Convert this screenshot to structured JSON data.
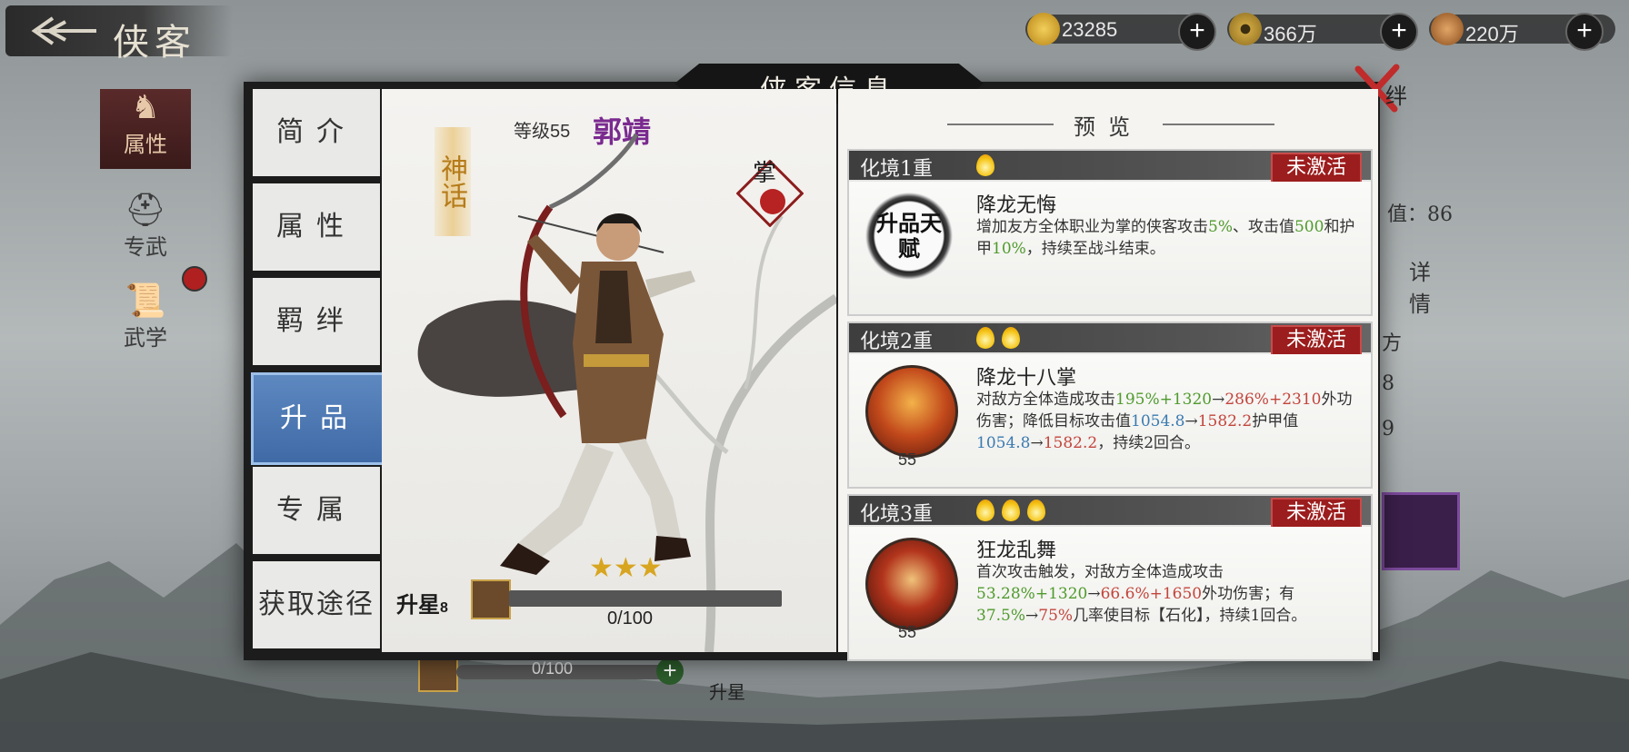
{
  "topbar": {
    "back_title": "侠客",
    "resources": [
      {
        "name": "gold-ingot",
        "value": "23285",
        "color": "#d9a62a"
      },
      {
        "name": "copper-coin",
        "value": "366万",
        "color": "#b98a2b"
      },
      {
        "name": "money-bag",
        "value": "220万",
        "color": "#c27a36"
      }
    ]
  },
  "left_nav": {
    "items": [
      {
        "label": "属性"
      },
      {
        "label": "专武"
      },
      {
        "label": "武学"
      }
    ]
  },
  "background": {
    "bottom_progress": "0/100",
    "bottom_label": "升星",
    "peek_values": [
      "值：86",
      "详情",
      "方",
      "8",
      "9"
    ]
  },
  "modal": {
    "title": "侠客信息",
    "close_label": "绊",
    "tabs": [
      {
        "label": "简介",
        "active": false
      },
      {
        "label": "属性",
        "active": false
      },
      {
        "label": "羁绊",
        "active": false
      },
      {
        "label": "升品",
        "active": true
      },
      {
        "label": "专属",
        "active": false
      },
      {
        "label": "获取途径",
        "active": false
      }
    ],
    "hero": {
      "rank": "神话",
      "level_label": "等级",
      "level": "55",
      "name": "郭靖",
      "seal": "掌",
      "stars": "★★★",
      "star_up_label": "升星",
      "star_up_count": "8",
      "star_progress": "0/100",
      "star_progress_fraction": 0
    },
    "preview": {
      "title": "预览",
      "cards": [
        {
          "tier": "化境1重",
          "suns": 1,
          "status": "未激活",
          "icon": "talent-seal-icon",
          "icon_text": "升品天赋",
          "level": "",
          "skill": "降龙无悔",
          "desc_parts": [
            {
              "t": "增加友方全体职业为掌的侠客攻击",
              "c": ""
            },
            {
              "t": "5%",
              "c": "g"
            },
            {
              "t": "、攻击值",
              "c": ""
            },
            {
              "t": "500",
              "c": "g"
            },
            {
              "t": "和护甲",
              "c": ""
            },
            {
              "t": "10%",
              "c": "g"
            },
            {
              "t": "，持续至战斗结束。",
              "c": ""
            }
          ]
        },
        {
          "tier": "化境2重",
          "suns": 2,
          "status": "未激活",
          "icon": "dragon-palm-icon",
          "level": "55",
          "skill": "降龙十八掌",
          "desc_parts": [
            {
              "t": "对敌方全体造成攻击",
              "c": ""
            },
            {
              "t": "195%+1320",
              "c": "g"
            },
            {
              "t": "→",
              "c": ""
            },
            {
              "t": "286%+2310",
              "c": "r"
            },
            {
              "t": "外功伤害；降低目标攻击值",
              "c": ""
            },
            {
              "t": "1054.8",
              "c": "b"
            },
            {
              "t": "→",
              "c": ""
            },
            {
              "t": "1582.2",
              "c": "r"
            },
            {
              "t": "护甲值",
              "c": ""
            },
            {
              "t": "1054.8",
              "c": "b"
            },
            {
              "t": "→",
              "c": ""
            },
            {
              "t": "1582.2",
              "c": "r"
            },
            {
              "t": "，持续2回合。",
              "c": ""
            }
          ]
        },
        {
          "tier": "化境3重",
          "suns": 3,
          "status": "未激活",
          "icon": "dragon-dance-icon",
          "level": "55",
          "skill": "狂龙乱舞",
          "desc_parts": [
            {
              "t": "首次攻击触发，对敌方全体造成攻击",
              "c": ""
            },
            {
              "t": "53.28%+1320",
              "c": "g"
            },
            {
              "t": "→",
              "c": ""
            },
            {
              "t": "66.6%+1650",
              "c": "r"
            },
            {
              "t": "外功伤害；有",
              "c": ""
            },
            {
              "t": "37.5%",
              "c": "g"
            },
            {
              "t": "→",
              "c": ""
            },
            {
              "t": "75%",
              "c": "r"
            },
            {
              "t": "几率使目标【石化】，持续1回合。",
              "c": ""
            }
          ]
        }
      ]
    }
  }
}
